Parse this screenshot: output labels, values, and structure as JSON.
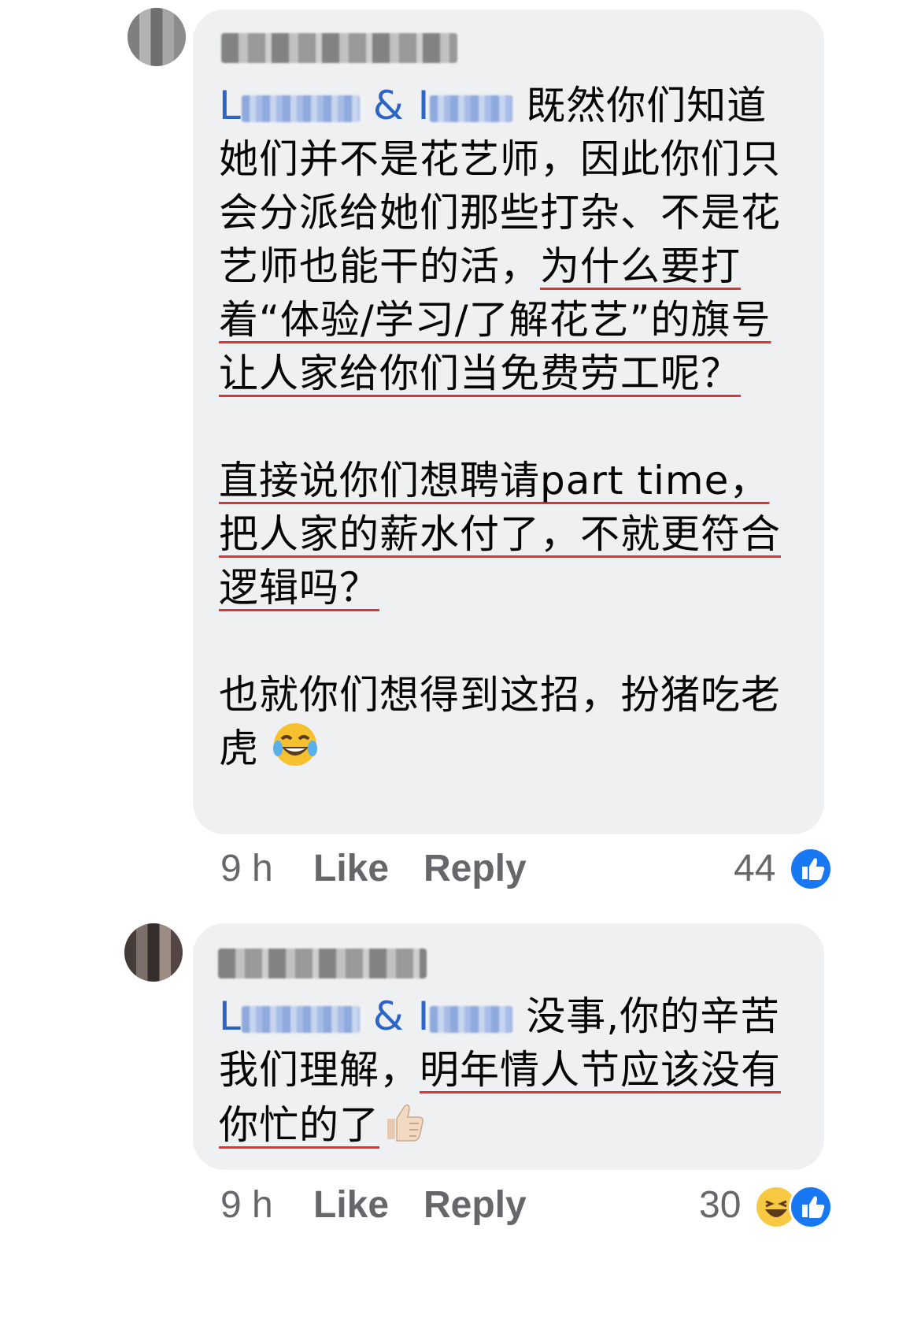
{
  "comments": [
    {
      "mention_first": "L",
      "mention_amp": "& I",
      "text_plain1": "既然你们知道她们并不是花艺师，因此你们只会分派给她们那些打杂、不是花艺师也能干的活，",
      "text_ul1": "为什么要打着“体验/学习/了解花艺”的旗号让人家给你们当免费劳工呢？",
      "text_ul2": "直接说你们想聘请part time，把人家的薪水付了，不就更符合逻辑吗？",
      "text_plain2": "也就你们想得到这招，扮猪吃老虎",
      "emoji_icon": "tears-of-joy-emoji",
      "time": "9 h",
      "like_label": "Like",
      "reply_label": "Reply",
      "reaction_count": "44"
    },
    {
      "mention_first": "L",
      "mention_amp": "& I",
      "text_plain1": "没事,你的辛苦我们理解，",
      "text_ul1": "明年情人节应该没有你忙的了",
      "emoji_icon": "thumbs-up-emoji",
      "time": "9 h",
      "like_label": "Like",
      "reply_label": "Reply",
      "reaction_count": "30"
    }
  ],
  "colors": {
    "underline": "#e8302e",
    "mention": "#2d64c8",
    "bubble": "#eff0f2",
    "like_badge": "#1877f2"
  }
}
